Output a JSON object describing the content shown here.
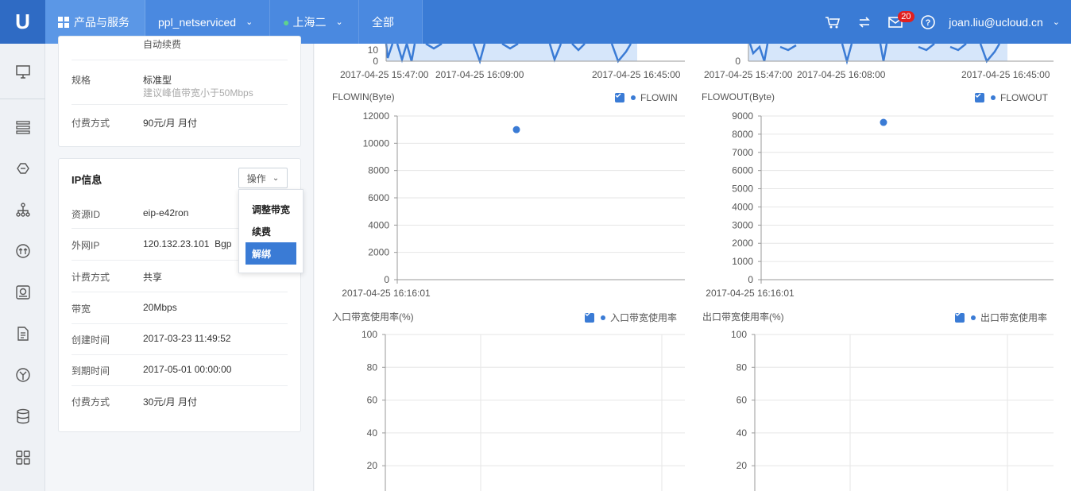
{
  "topbar": {
    "logo": "U",
    "products": "产品与服务",
    "project": "ppl_netserviced",
    "region": "上海二",
    "scope": "全部",
    "badge": "20",
    "user": "joan.liu@ucloud.cn"
  },
  "top_card": {
    "partial_text": "自动续费",
    "rows": [
      {
        "label": "规格",
        "value": "标准型",
        "sub": "建议峰值带宽小于50Mbps"
      },
      {
        "label": "付费方式",
        "value": "90元/月 月付"
      }
    ]
  },
  "ip_card": {
    "title": "IP信息",
    "op_button": "操作",
    "rows": [
      {
        "label": "资源ID",
        "value": "eip-e42ron"
      },
      {
        "label": "外网IP",
        "value": "120.132.23.101  Bgp"
      },
      {
        "label": "计费方式",
        "value": "共享"
      },
      {
        "label": "带宽",
        "value": "20Mbps"
      },
      {
        "label": "创建时间",
        "value": "2017-03-23 11:49:52"
      },
      {
        "label": "到期时间",
        "value": "2017-05-01 00:00:00"
      },
      {
        "label": "付费方式",
        "value": "30元/月 月付"
      }
    ]
  },
  "dropdown": {
    "items": [
      "调整带宽",
      "续费",
      "解绑"
    ],
    "active_index": 2
  },
  "accent": "#3a7bd5",
  "chart_data": [
    {
      "type": "area",
      "title": "",
      "xlabel": "",
      "ylabel": "",
      "x_ticks": [
        "2017-04-25 15:47:00",
        "2017-04-25 16:09:00",
        "2017-04-25 16:45:00"
      ],
      "y_ticks": [
        10,
        0
      ],
      "legend": "",
      "note": "partially visible top-left chart"
    },
    {
      "type": "area",
      "title": "",
      "xlabel": "",
      "ylabel": "",
      "x_ticks": [
        "2017-04-25 15:47:00",
        "2017-04-25 16:08:00",
        "2017-04-25 16:45:00"
      ],
      "y_ticks": [
        0
      ],
      "legend": "",
      "note": "partially visible top-right chart"
    },
    {
      "type": "scatter",
      "title": "FLOWIN(Byte)",
      "legend": "FLOWIN",
      "x": [
        "2017-04-25 16:16:01"
      ],
      "series": [
        {
          "name": "FLOWIN",
          "values": [
            11000
          ]
        }
      ],
      "ylim": [
        0,
        12000
      ],
      "y_ticks": [
        0,
        2000,
        4000,
        6000,
        8000,
        10000,
        12000
      ],
      "grid": true
    },
    {
      "type": "scatter",
      "title": "FLOWOUT(Byte)",
      "legend": "FLOWOUT",
      "x": [
        "2017-04-25 16:16:01"
      ],
      "series": [
        {
          "name": "FLOWOUT",
          "values": [
            8650
          ]
        }
      ],
      "ylim": [
        0,
        9000
      ],
      "y_ticks": [
        0,
        1000,
        2000,
        3000,
        4000,
        5000,
        6000,
        7000,
        8000,
        9000
      ],
      "grid": true
    },
    {
      "type": "line",
      "title": "入口带宽使用率(%)",
      "legend": "入口带宽使用率",
      "y_ticks": [
        20,
        40,
        60,
        80,
        100
      ],
      "ylim": [
        0,
        100
      ],
      "grid": true
    },
    {
      "type": "line",
      "title": "出口带宽使用率(%)",
      "legend": "出口带宽使用率",
      "y_ticks": [
        20,
        40,
        60,
        80,
        100
      ],
      "ylim": [
        0,
        100
      ],
      "grid": true
    }
  ]
}
